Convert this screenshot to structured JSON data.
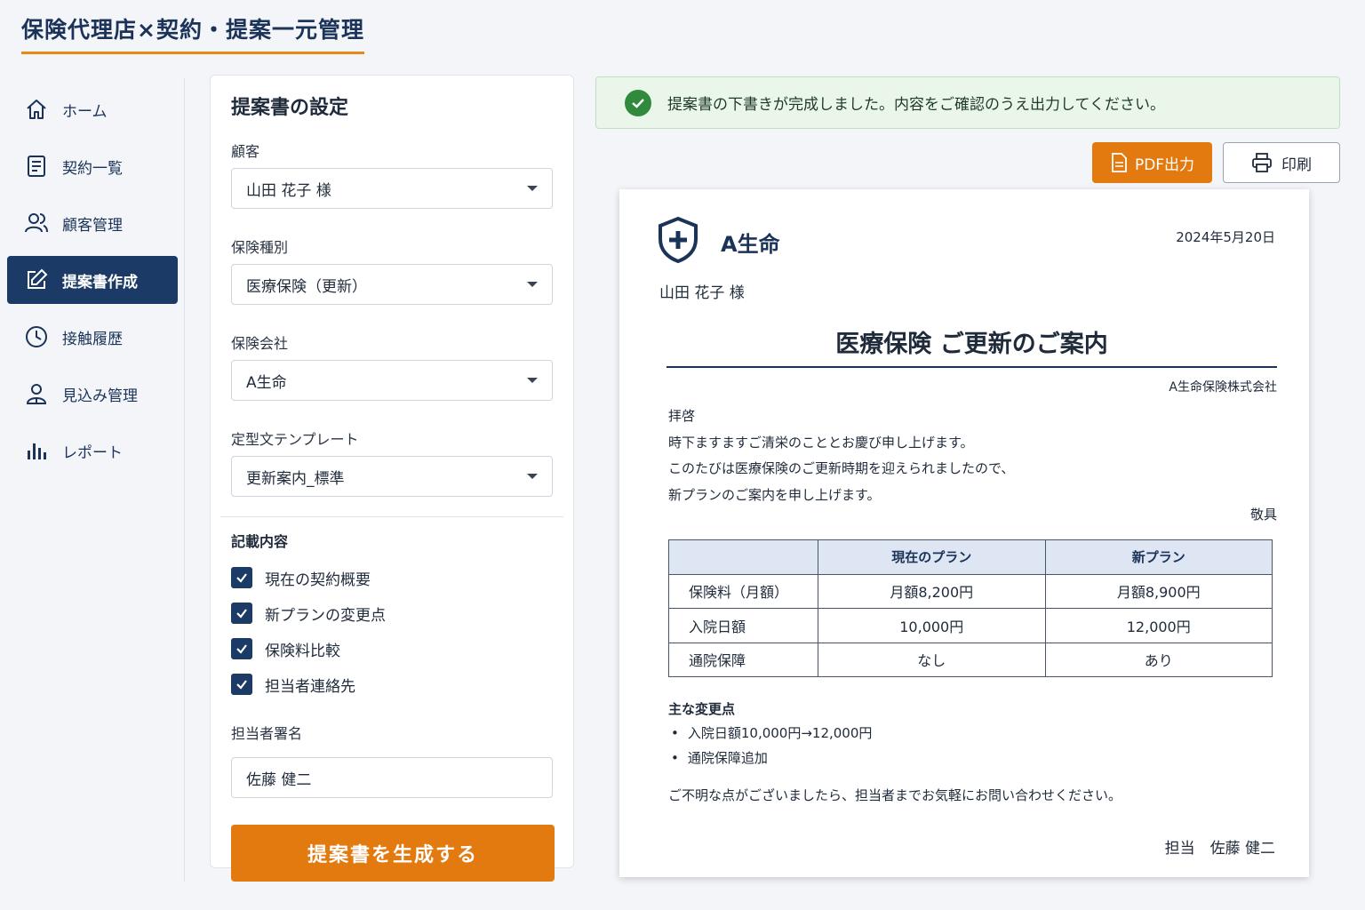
{
  "app": {
    "title": "保険代理店×契約・提案一元管理"
  },
  "sidebar": {
    "items": [
      {
        "label": "ホーム",
        "icon": "home-icon",
        "active": false
      },
      {
        "label": "契約一覧",
        "icon": "document-list-icon",
        "active": false
      },
      {
        "label": "顧客管理",
        "icon": "users-icon",
        "active": false
      },
      {
        "label": "提案書作成",
        "icon": "edit-icon",
        "active": true
      },
      {
        "label": "接触履歴",
        "icon": "clock-icon",
        "active": false
      },
      {
        "label": "見込み管理",
        "icon": "prospect-user-icon",
        "active": false
      },
      {
        "label": "レポート",
        "icon": "bar-chart-icon",
        "active": false
      }
    ]
  },
  "settings": {
    "title": "提案書の設定",
    "customer_label": "顧客",
    "customer_value": "山田 花子 様",
    "insurance_type_label": "保険種別",
    "insurance_type_value": "医療保険（更新）",
    "company_label": "保険会社",
    "company_value": "A生命",
    "template_label": "定型文テンプレート",
    "template_value": "更新案内_標準",
    "contents_title": "記載内容",
    "contents": [
      {
        "label": "現在の契約概要",
        "checked": true
      },
      {
        "label": "新プランの変更点",
        "checked": true
      },
      {
        "label": "保険料比較",
        "checked": true
      },
      {
        "label": "担当者連絡先",
        "checked": true
      }
    ],
    "signature_label": "担当者署名",
    "signature_value": "佐藤 健二",
    "generate_label": "提案書を生成する"
  },
  "alert": {
    "message": "提案書の下書きが完成しました。内容をご確認のうえ出力してください。"
  },
  "toolbar": {
    "pdf_label": "PDF出力",
    "print_label": "印刷"
  },
  "document": {
    "brand": "A生命",
    "date": "2024年5月20日",
    "recipient": "山田 花子 様",
    "title": "医療保険 ご更新のご案内",
    "company": "A生命保険株式会社",
    "greeting": "拝啓",
    "body_lines": [
      "時下ますますご清栄のこととお慶び申し上げます。",
      "このたびは医療保険のご更新時期を迎えられましたので、",
      "新プランのご案内を申し上げます。"
    ],
    "closing": "敬具",
    "table": {
      "headers": [
        "",
        "現在のプラン",
        "新プラン"
      ],
      "rows": [
        [
          "保険料（月額）",
          "月額8,200円",
          "月額8,900円"
        ],
        [
          "入院日額",
          "10,000円",
          "12,000円"
        ],
        [
          "通院保障",
          "なし",
          "あり"
        ]
      ]
    },
    "changes_title": "主な変更点",
    "changes": [
      "入院日額10,000円→12,000円",
      "通院保障追加"
    ],
    "contact": "ご不明な点がございましたら、担当者までお気軽にお問い合わせください。",
    "sign": "担当　佐藤 健二"
  },
  "colors": {
    "accent": "#e37a10",
    "navy": "#1b3a66",
    "success": "#2f8a3b"
  }
}
